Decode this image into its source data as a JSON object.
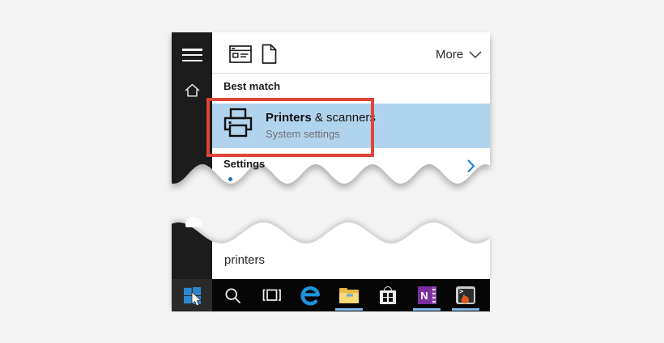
{
  "top_panel": {
    "more_label": "More",
    "sections": {
      "best_match": "Best match",
      "settings": "Settings"
    },
    "result": {
      "title_bold": "Printers",
      "title_rest": " & scanners",
      "subtitle": "System settings"
    }
  },
  "search_box": {
    "value": "printers"
  },
  "taskbar": {
    "onenote_letter": "N",
    "terminal_prompt": ">",
    "items": [
      {
        "name": "start",
        "running": false
      },
      {
        "name": "search",
        "running": false
      },
      {
        "name": "task-view",
        "running": false
      },
      {
        "name": "edge",
        "running": false
      },
      {
        "name": "file-explorer",
        "running": true
      },
      {
        "name": "store",
        "running": false
      },
      {
        "name": "onenote",
        "running": true
      },
      {
        "name": "terminal",
        "running": true
      }
    ]
  },
  "colors": {
    "highlight_blue": "#b1d4ee",
    "annotation_red": "#dc4638",
    "accent_blue": "#1283d8",
    "underline_blue": "#7fb9e8",
    "windows_blue": "#2e86cf"
  }
}
